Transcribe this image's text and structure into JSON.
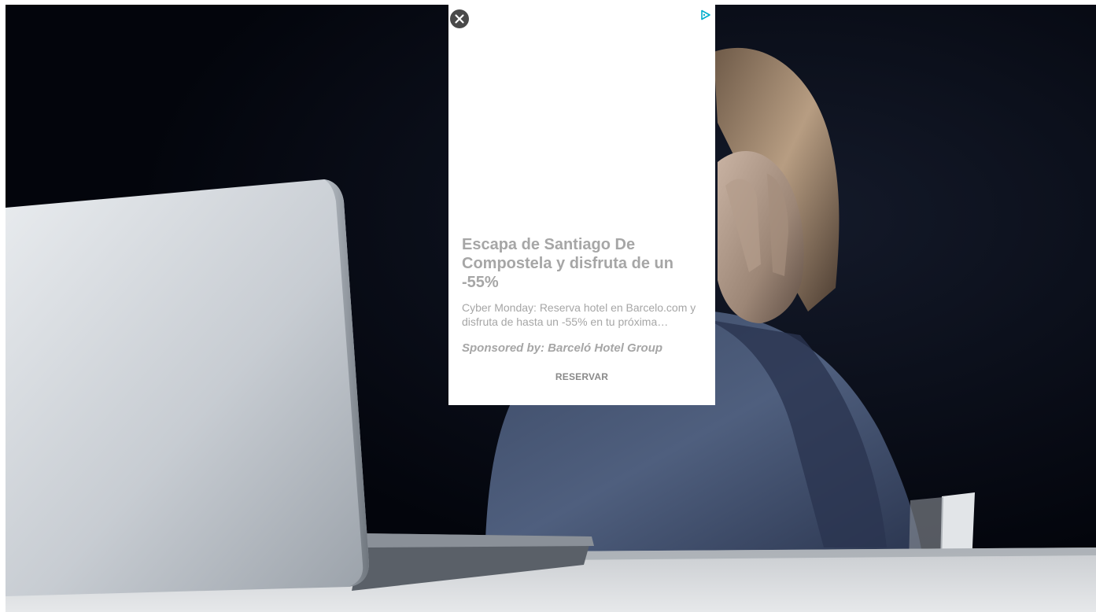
{
  "background": {
    "image": "person-covering-face-at-laptop-photo"
  },
  "ad": {
    "close_icon": "close-icon",
    "adchoices_icon": "adchoices-icon",
    "title": "Escapa de Santiago De Compostela y disfruta de un -55%",
    "description": "Cyber Monday: Reserva hotel en Barcelo.com y disfruta de hasta un -55% en tu próxima escapada",
    "sponsor": "Sponsored by: Barceló Hotel Group",
    "cta_label": "RESERVAR",
    "colors": {
      "text": "#a6a6a6",
      "close_bg": "#4a4a4a",
      "adchoices": "#00aecd"
    }
  }
}
